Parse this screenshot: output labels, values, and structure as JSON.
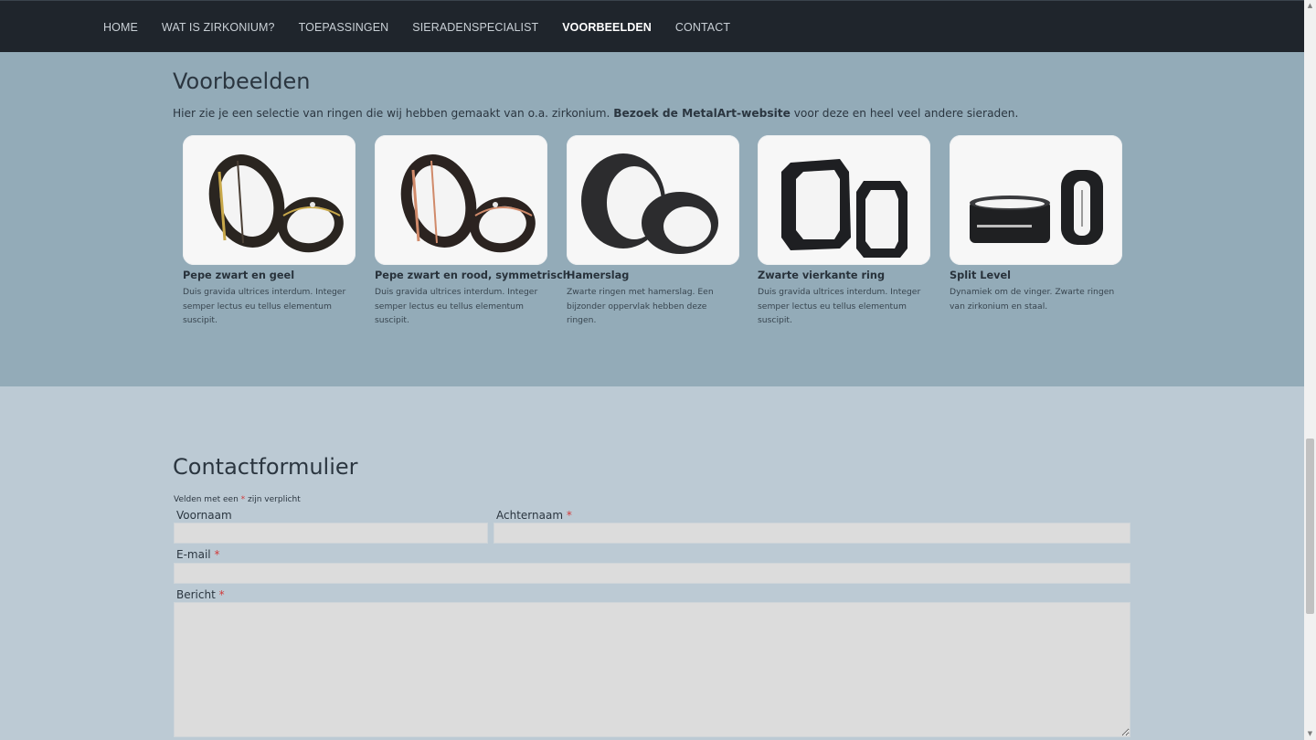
{
  "nav": {
    "items": [
      {
        "label": "HOME",
        "active": false
      },
      {
        "label": "WAT IS ZIRKONIUM?",
        "active": false
      },
      {
        "label": "TOEPASSINGEN",
        "active": false
      },
      {
        "label": "SIERADENSPECIALIST",
        "active": false
      },
      {
        "label": "VOORBEELDEN",
        "active": true
      },
      {
        "label": "CONTACT",
        "active": false
      }
    ]
  },
  "examples": {
    "title": "Voorbeelden",
    "intro_before": "Hier zie je een selectie van ringen die wij hebben gemaakt van o.a. zirkonium. ",
    "intro_link": "Bezoek de MetalArt-website",
    "intro_after": " voor deze en heel veel andere sieraden.",
    "cards": [
      {
        "title": "Pepe zwart en geel",
        "desc": "Duis gravida ultrices interdum. Integer semper lectus eu tellus elementum suscipit."
      },
      {
        "title": "Pepe zwart en rood, symmetrisch",
        "desc": "Duis gravida ultrices interdum. Integer semper lectus eu tellus elementum suscipit."
      },
      {
        "title": "Hamerslag",
        "desc": "Zwarte ringen met hamerslag. Een bijzonder oppervlak hebben deze ringen."
      },
      {
        "title": "Zwarte vierkante ring",
        "desc": "Duis gravida ultrices interdum. Integer semper lectus eu tellus elementum suscipit."
      },
      {
        "title": "Split Level",
        "desc": "Dynamiek om de vinger. Zwarte ringen van zirkonium en staal."
      }
    ]
  },
  "contact": {
    "title": "Contactformulier",
    "required_note_before": "Velden met een ",
    "required_mark": "*",
    "required_note_after": " zijn verplicht",
    "fields": {
      "firstname_label": "Voornaam",
      "lastname_label": "Achternaam",
      "email_label": "E-mail",
      "message_label": "Bericht"
    }
  },
  "colors": {
    "nav_bg": "#1f252c",
    "section_examples_bg": "#93abb8",
    "section_contact_bg": "#bccad4",
    "required": "#d23b3b"
  }
}
